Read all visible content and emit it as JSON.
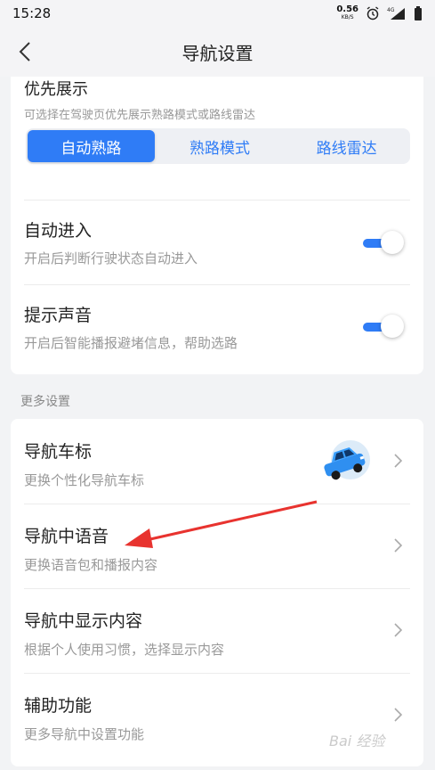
{
  "status_bar": {
    "time": "15:28",
    "net_speed_value": "0.56",
    "net_speed_unit": "KB/S",
    "icons": [
      "alarm-icon",
      "signal-4g-icon",
      "battery-icon"
    ]
  },
  "nav": {
    "title": "导航设置",
    "back_icon": "chevron-left-icon"
  },
  "priority": {
    "title": "优先展示",
    "subtitle": "可选择在驾驶页优先展示熟路模式或路线雷达",
    "options": [
      "自动熟路",
      "熟路模式",
      "路线雷达"
    ],
    "selected": "自动熟路"
  },
  "auto_enter": {
    "title": "自动进入",
    "subtitle": "开启后判断行驶状态自动进入",
    "enabled": true
  },
  "sound_alert": {
    "title": "提示声音",
    "subtitle": "开启后智能播报避堵信息，帮助选路",
    "enabled": true
  },
  "more_settings": {
    "label": "更多设置",
    "items": [
      {
        "title": "导航车标",
        "subtitle": "更换个性化导航车标"
      },
      {
        "title": "导航中语音",
        "subtitle": "更换语音包和播报内容"
      },
      {
        "title": "导航中显示内容",
        "subtitle": "根据个人使用习惯，选择显示内容"
      },
      {
        "title": "辅助功能",
        "subtitle": "更多导航中设置功能"
      }
    ]
  },
  "watermark": "Bai 经验",
  "colors": {
    "accent": "#2f7cf6",
    "annotation_arrow": "#e8332f"
  }
}
